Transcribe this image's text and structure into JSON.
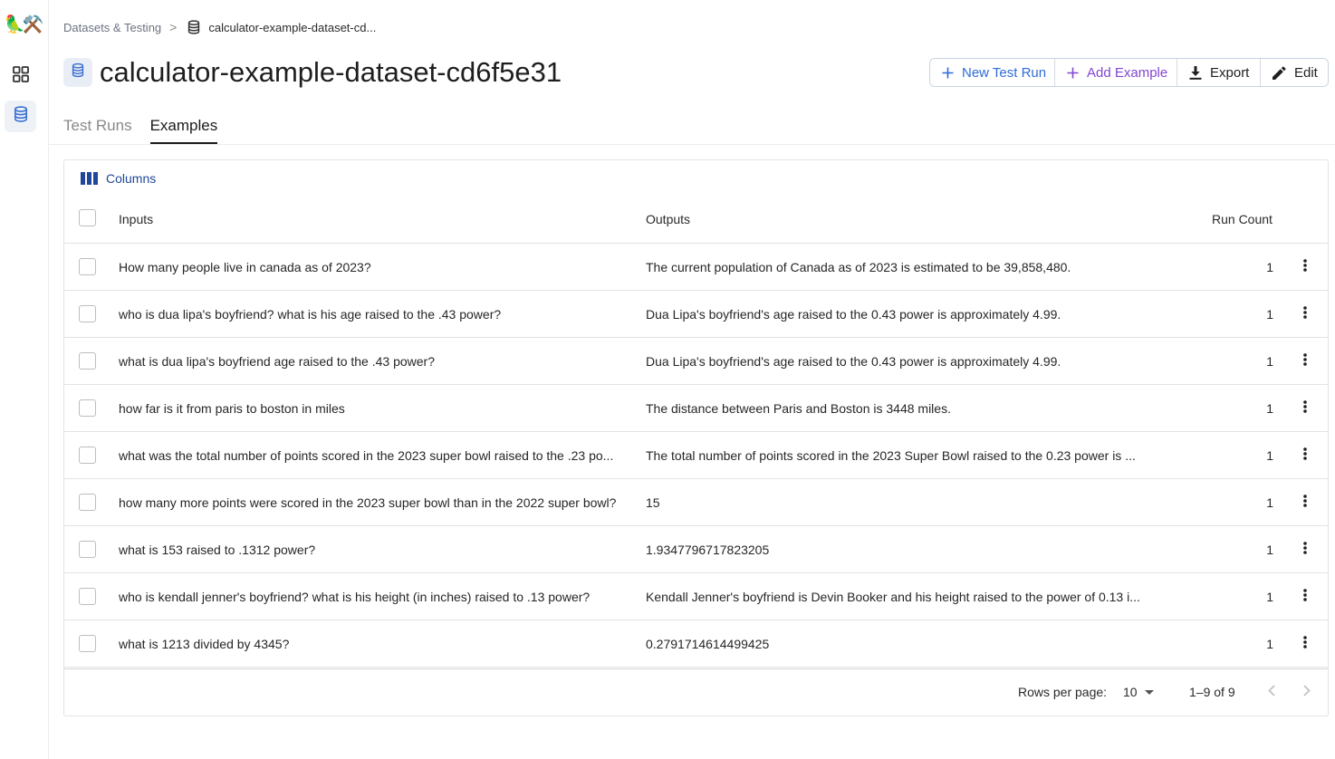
{
  "logo": {
    "glyph": "🦜⚒️"
  },
  "breadcrumb": {
    "parent": "Datasets & Testing",
    "separator": ">",
    "current": "calculator-example-dataset-cd..."
  },
  "page": {
    "title": "calculator-example-dataset-cd6f5e31"
  },
  "toolbar": {
    "new_test_run": "New Test Run",
    "add_example": "Add Example",
    "export": "Export",
    "edit": "Edit"
  },
  "tabs": [
    {
      "label": "Test Runs",
      "active": false
    },
    {
      "label": "Examples",
      "active": true
    }
  ],
  "table": {
    "columns_button": "Columns",
    "headers": {
      "inputs": "Inputs",
      "outputs": "Outputs",
      "run_count": "Run Count"
    },
    "rows": [
      {
        "input": "How many people live in canada as of 2023?",
        "output": "The current population of Canada as of 2023 is estimated to be 39,858,480.",
        "run_count": "1"
      },
      {
        "input": "who is dua lipa's boyfriend? what is his age raised to the .43 power?",
        "output": "Dua Lipa's boyfriend's age raised to the 0.43 power is approximately 4.99.",
        "run_count": "1"
      },
      {
        "input": "what is dua lipa's boyfriend age raised to the .43 power?",
        "output": "Dua Lipa's boyfriend's age raised to the 0.43 power is approximately 4.99.",
        "run_count": "1"
      },
      {
        "input": "how far is it from paris to boston in miles",
        "output": "The distance between Paris and Boston is 3448 miles.",
        "run_count": "1"
      },
      {
        "input": "what was the total number of points scored in the 2023 super bowl raised to the .23 po...",
        "output": "The total number of points scored in the 2023 Super Bowl raised to the 0.23 power is ...",
        "run_count": "1"
      },
      {
        "input": "how many more points were scored in the 2023 super bowl than in the 2022 super bowl?",
        "output": "15",
        "run_count": "1"
      },
      {
        "input": "what is 153 raised to .1312 power?",
        "output": "1.9347796717823205",
        "run_count": "1"
      },
      {
        "input": "who is kendall jenner's boyfriend? what is his height (in inches) raised to .13 power?",
        "output": "Kendall Jenner's boyfriend is Devin Booker and his height raised to the power of 0.13 i...",
        "run_count": "1"
      },
      {
        "input": "what is 1213 divided by 4345?",
        "output": "0.2791714614499425",
        "run_count": "1"
      }
    ]
  },
  "pagination": {
    "rows_per_page_label": "Rows per page:",
    "rows_per_page_value": "10",
    "range": "1–9 of 9"
  },
  "colors": {
    "accent_blue": "#2e6bd8",
    "accent_purple": "#8147d1",
    "columns_blue": "#21479a",
    "db_icon_blue": "#3b6fd1"
  }
}
